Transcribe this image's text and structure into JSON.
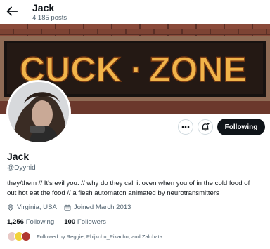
{
  "header": {
    "name": "Jack",
    "post_count": "4,185 posts"
  },
  "banner": {
    "text_left": "CUCK",
    "text_dot": "·",
    "text_right": "ZONE",
    "colors": {
      "brick": "#5a2f26",
      "sign": "#f1b44a",
      "panel": "#171210"
    }
  },
  "actions": {
    "follow_label": "Following"
  },
  "profile": {
    "display_name": "Jack",
    "handle": "@Dyynid",
    "bio_line1": "they/them // It's evil you. // why do they call it oven when you of in the cold food of",
    "bio_line2": "out hot eat the food // a flesh automaton animated by neurotransmitters",
    "location": "Virginia, USA",
    "joined": "Joined March 2013"
  },
  "stats": {
    "following_count": "1,256",
    "following_label": "Following",
    "followers_count": "100",
    "followers_label": "Followers"
  },
  "followed_by": {
    "text": "Followed by Reggie, Phijkchu_Pikachu, and Zalchata"
  },
  "colors": {
    "text": "#0f1419",
    "muted": "#536471",
    "follow_button": "#0f1419"
  }
}
